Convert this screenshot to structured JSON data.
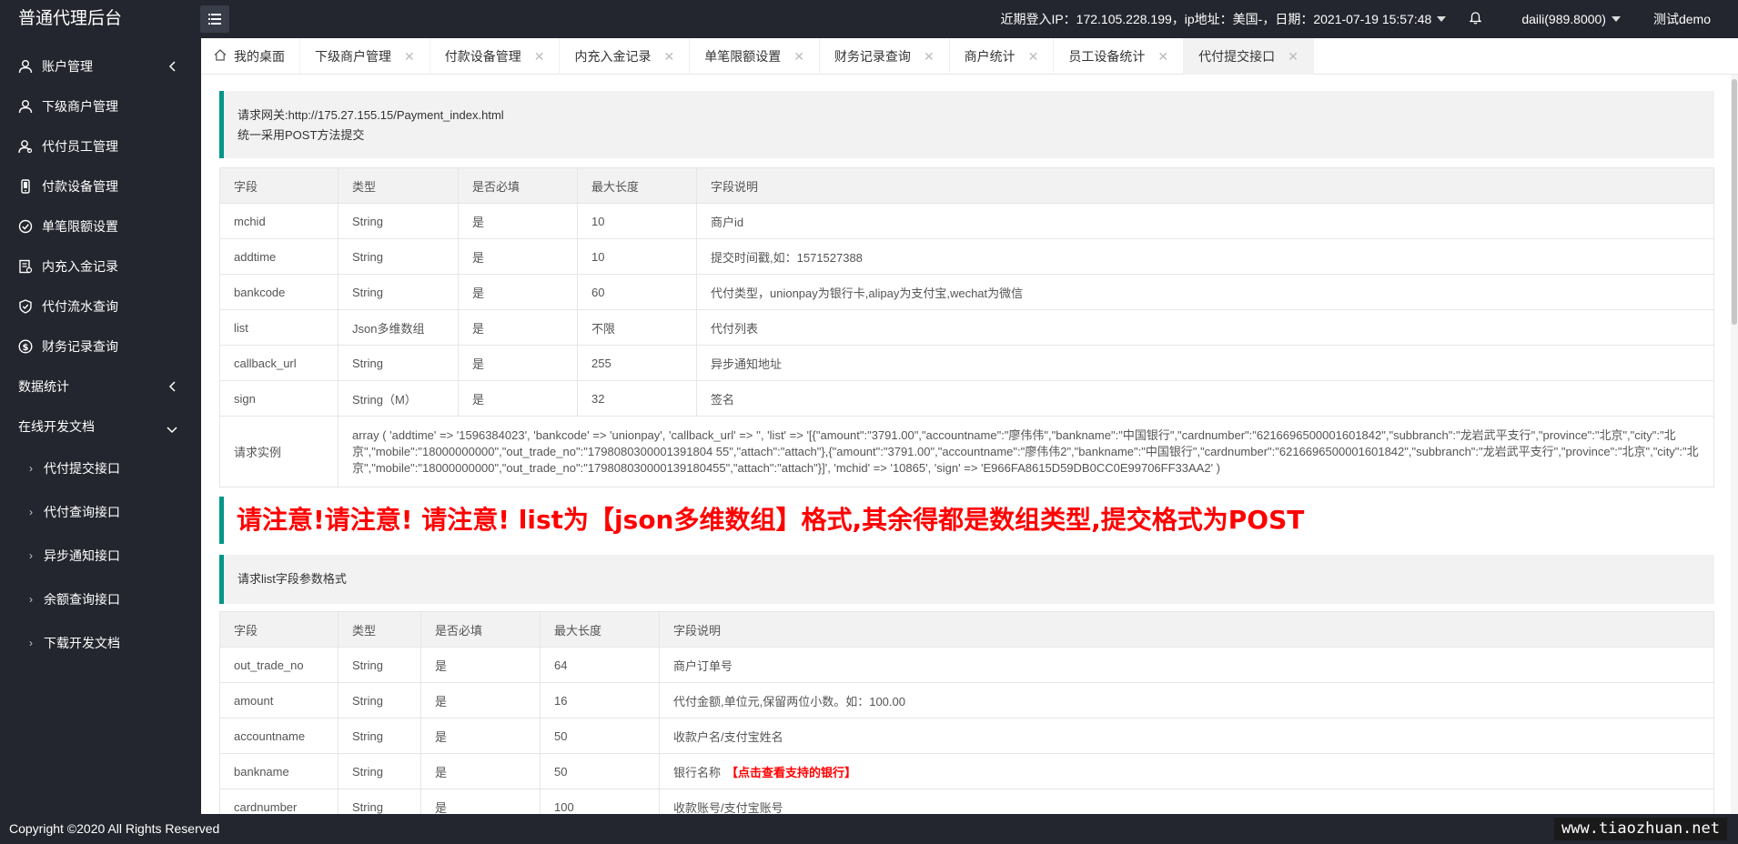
{
  "header": {
    "logo": "普通代理后台",
    "login_info": "近期登入IP：172.105.228.199，ip地址：美国-，日期：2021-07-19 15:57:48",
    "user": "daili(989.8000)",
    "user_name": "测试demo"
  },
  "sidebar": {
    "items": [
      {
        "label": "账户管理",
        "icon": "user-icon"
      },
      {
        "label": "下级商户管理",
        "icon": "user-icon"
      },
      {
        "label": "代付员工管理",
        "icon": "user-group-icon"
      },
      {
        "label": "付款设备管理",
        "icon": "phone-icon"
      },
      {
        "label": "单笔限额设置",
        "icon": "check-circle-icon"
      },
      {
        "label": "内充入金记录",
        "icon": "doc-icon"
      },
      {
        "label": "代付流水查询",
        "icon": "shield-icon"
      },
      {
        "label": "财务记录查询",
        "icon": "dollar-icon"
      }
    ],
    "group_stats": "数据统计",
    "group_docs": "在线开发文档",
    "sub_items": [
      "代付提交接口",
      "代付查询接口",
      "异步通知接口",
      "余额查询接口",
      "下载开发文档"
    ]
  },
  "tabs": [
    {
      "label": "我的桌面"
    },
    {
      "label": "下级商户管理"
    },
    {
      "label": "付款设备管理"
    },
    {
      "label": "内充入金记录"
    },
    {
      "label": "单笔限额设置"
    },
    {
      "label": "财务记录查询"
    },
    {
      "label": "商户统计"
    },
    {
      "label": "员工设备统计"
    },
    {
      "label": "代付提交接口"
    }
  ],
  "main": {
    "gateway_line": "请求网关:http://175.27.155.15/Payment_index.html",
    "method_line": "统一采用POST方法提交",
    "table1": {
      "headers": [
        "字段",
        "类型",
        "是否必填",
        "最大长度",
        "字段说明"
      ],
      "rows": [
        [
          "mchid",
          "String",
          "是",
          "10",
          "商户id"
        ],
        [
          "addtime",
          "String",
          "是",
          "10",
          "提交时间戳,如：1571527388"
        ],
        [
          "bankcode",
          "String",
          "是",
          "60",
          "代付类型，unionpay为银行卡,alipay为支付宝,wechat为微信"
        ],
        [
          "list",
          "Json多维数组",
          "是",
          "不限",
          "代付列表"
        ],
        [
          "callback_url",
          "String",
          "是",
          "255",
          "异步通知地址"
        ],
        [
          "sign",
          "String（M）",
          "是",
          "32",
          "签名"
        ]
      ],
      "example_label": "请求实例",
      "example_value": "array ( 'addtime' => '1596384023', 'bankcode' => 'unionpay', 'callback_url' => '', 'list' => '[{\"amount\":\"3791.00\",\"accountname\":\"廖伟伟\",\"bankname\":\"中国银行\",\"cardnumber\":\"6216696500001601842\",\"subbranch\":\"龙岩武平支行\",\"province\":\"北京\",\"city\":\"北京\",\"mobile\":\"18000000000\",\"out_trade_no\":\"1798080300001391804 55\",\"attach\":\"attach\"},{\"amount\":\"3791.00\",\"accountname\":\"廖伟伟2\",\"bankname\":\"中国银行\",\"cardnumber\":\"6216696500001601842\",\"subbranch\":\"龙岩武平支行\",\"province\":\"北京\",\"city\":\"北京\",\"mobile\":\"18000000000\",\"out_trade_no\":\"179808030000139180455\",\"attach\":\"attach\"}]', 'mchid' => '10865', 'sign' => 'E966FA8615D59DB0CC0E99706FF33AA2' )"
    },
    "alert": "请注意!请注意! 请注意! list为【json多维数组】格式,其余得都是数组类型,提交格式为POST",
    "list_title": "请求list字段参数格式",
    "table2": {
      "headers": [
        "字段",
        "类型",
        "是否必填",
        "最大长度",
        "字段说明"
      ],
      "rows": [
        [
          "out_trade_no",
          "String",
          "是",
          "64",
          "商户订单号"
        ],
        [
          "amount",
          "String",
          "是",
          "16",
          "代付金额,单位元,保留两位小数。如：100.00"
        ],
        [
          "accountname",
          "String",
          "是",
          "50",
          "收款户名/支付宝姓名"
        ],
        [
          "bankname",
          "String",
          "是",
          "50",
          "银行名称"
        ],
        [
          "cardnumber",
          "String",
          "是",
          "100",
          "收款账号/支付宝账号"
        ]
      ],
      "bank_link": "【点击查看支持的银行】"
    }
  },
  "footer": {
    "copyright": "Copyright ©2020 All Rights Reserved",
    "watermark": "www.tiaozhuan.net"
  }
}
